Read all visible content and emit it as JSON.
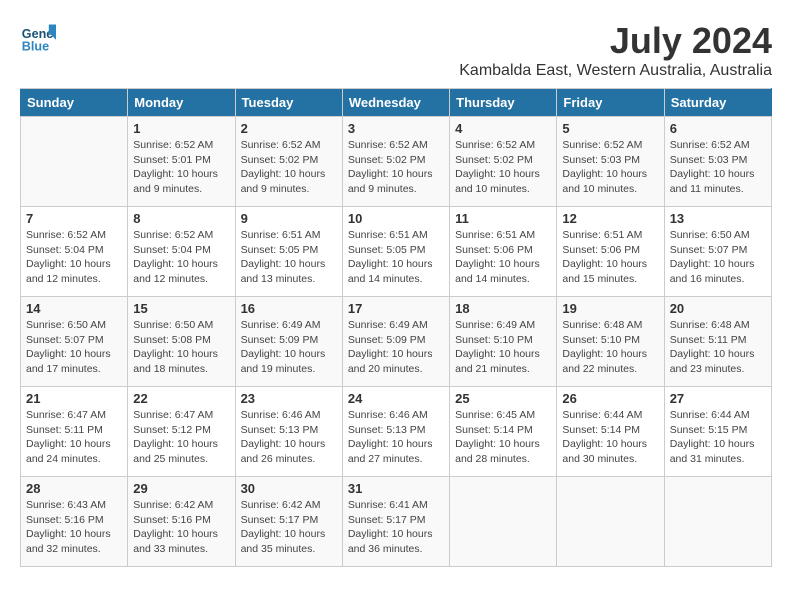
{
  "header": {
    "logo_line1": "General",
    "logo_line2": "Blue",
    "month": "July 2024",
    "location": "Kambalda East, Western Australia, Australia"
  },
  "days_of_week": [
    "Sunday",
    "Monday",
    "Tuesday",
    "Wednesday",
    "Thursday",
    "Friday",
    "Saturday"
  ],
  "weeks": [
    [
      {
        "day": "",
        "info": ""
      },
      {
        "day": "1",
        "info": "Sunrise: 6:52 AM\nSunset: 5:01 PM\nDaylight: 10 hours\nand 9 minutes."
      },
      {
        "day": "2",
        "info": "Sunrise: 6:52 AM\nSunset: 5:02 PM\nDaylight: 10 hours\nand 9 minutes."
      },
      {
        "day": "3",
        "info": "Sunrise: 6:52 AM\nSunset: 5:02 PM\nDaylight: 10 hours\nand 9 minutes."
      },
      {
        "day": "4",
        "info": "Sunrise: 6:52 AM\nSunset: 5:02 PM\nDaylight: 10 hours\nand 10 minutes."
      },
      {
        "day": "5",
        "info": "Sunrise: 6:52 AM\nSunset: 5:03 PM\nDaylight: 10 hours\nand 10 minutes."
      },
      {
        "day": "6",
        "info": "Sunrise: 6:52 AM\nSunset: 5:03 PM\nDaylight: 10 hours\nand 11 minutes."
      }
    ],
    [
      {
        "day": "7",
        "info": "Sunrise: 6:52 AM\nSunset: 5:04 PM\nDaylight: 10 hours\nand 12 minutes."
      },
      {
        "day": "8",
        "info": "Sunrise: 6:52 AM\nSunset: 5:04 PM\nDaylight: 10 hours\nand 12 minutes."
      },
      {
        "day": "9",
        "info": "Sunrise: 6:51 AM\nSunset: 5:05 PM\nDaylight: 10 hours\nand 13 minutes."
      },
      {
        "day": "10",
        "info": "Sunrise: 6:51 AM\nSunset: 5:05 PM\nDaylight: 10 hours\nand 14 minutes."
      },
      {
        "day": "11",
        "info": "Sunrise: 6:51 AM\nSunset: 5:06 PM\nDaylight: 10 hours\nand 14 minutes."
      },
      {
        "day": "12",
        "info": "Sunrise: 6:51 AM\nSunset: 5:06 PM\nDaylight: 10 hours\nand 15 minutes."
      },
      {
        "day": "13",
        "info": "Sunrise: 6:50 AM\nSunset: 5:07 PM\nDaylight: 10 hours\nand 16 minutes."
      }
    ],
    [
      {
        "day": "14",
        "info": "Sunrise: 6:50 AM\nSunset: 5:07 PM\nDaylight: 10 hours\nand 17 minutes."
      },
      {
        "day": "15",
        "info": "Sunrise: 6:50 AM\nSunset: 5:08 PM\nDaylight: 10 hours\nand 18 minutes."
      },
      {
        "day": "16",
        "info": "Sunrise: 6:49 AM\nSunset: 5:09 PM\nDaylight: 10 hours\nand 19 minutes."
      },
      {
        "day": "17",
        "info": "Sunrise: 6:49 AM\nSunset: 5:09 PM\nDaylight: 10 hours\nand 20 minutes."
      },
      {
        "day": "18",
        "info": "Sunrise: 6:49 AM\nSunset: 5:10 PM\nDaylight: 10 hours\nand 21 minutes."
      },
      {
        "day": "19",
        "info": "Sunrise: 6:48 AM\nSunset: 5:10 PM\nDaylight: 10 hours\nand 22 minutes."
      },
      {
        "day": "20",
        "info": "Sunrise: 6:48 AM\nSunset: 5:11 PM\nDaylight: 10 hours\nand 23 minutes."
      }
    ],
    [
      {
        "day": "21",
        "info": "Sunrise: 6:47 AM\nSunset: 5:11 PM\nDaylight: 10 hours\nand 24 minutes."
      },
      {
        "day": "22",
        "info": "Sunrise: 6:47 AM\nSunset: 5:12 PM\nDaylight: 10 hours\nand 25 minutes."
      },
      {
        "day": "23",
        "info": "Sunrise: 6:46 AM\nSunset: 5:13 PM\nDaylight: 10 hours\nand 26 minutes."
      },
      {
        "day": "24",
        "info": "Sunrise: 6:46 AM\nSunset: 5:13 PM\nDaylight: 10 hours\nand 27 minutes."
      },
      {
        "day": "25",
        "info": "Sunrise: 6:45 AM\nSunset: 5:14 PM\nDaylight: 10 hours\nand 28 minutes."
      },
      {
        "day": "26",
        "info": "Sunrise: 6:44 AM\nSunset: 5:14 PM\nDaylight: 10 hours\nand 30 minutes."
      },
      {
        "day": "27",
        "info": "Sunrise: 6:44 AM\nSunset: 5:15 PM\nDaylight: 10 hours\nand 31 minutes."
      }
    ],
    [
      {
        "day": "28",
        "info": "Sunrise: 6:43 AM\nSunset: 5:16 PM\nDaylight: 10 hours\nand 32 minutes."
      },
      {
        "day": "29",
        "info": "Sunrise: 6:42 AM\nSunset: 5:16 PM\nDaylight: 10 hours\nand 33 minutes."
      },
      {
        "day": "30",
        "info": "Sunrise: 6:42 AM\nSunset: 5:17 PM\nDaylight: 10 hours\nand 35 minutes."
      },
      {
        "day": "31",
        "info": "Sunrise: 6:41 AM\nSunset: 5:17 PM\nDaylight: 10 hours\nand 36 minutes."
      },
      {
        "day": "",
        "info": ""
      },
      {
        "day": "",
        "info": ""
      },
      {
        "day": "",
        "info": ""
      }
    ]
  ]
}
